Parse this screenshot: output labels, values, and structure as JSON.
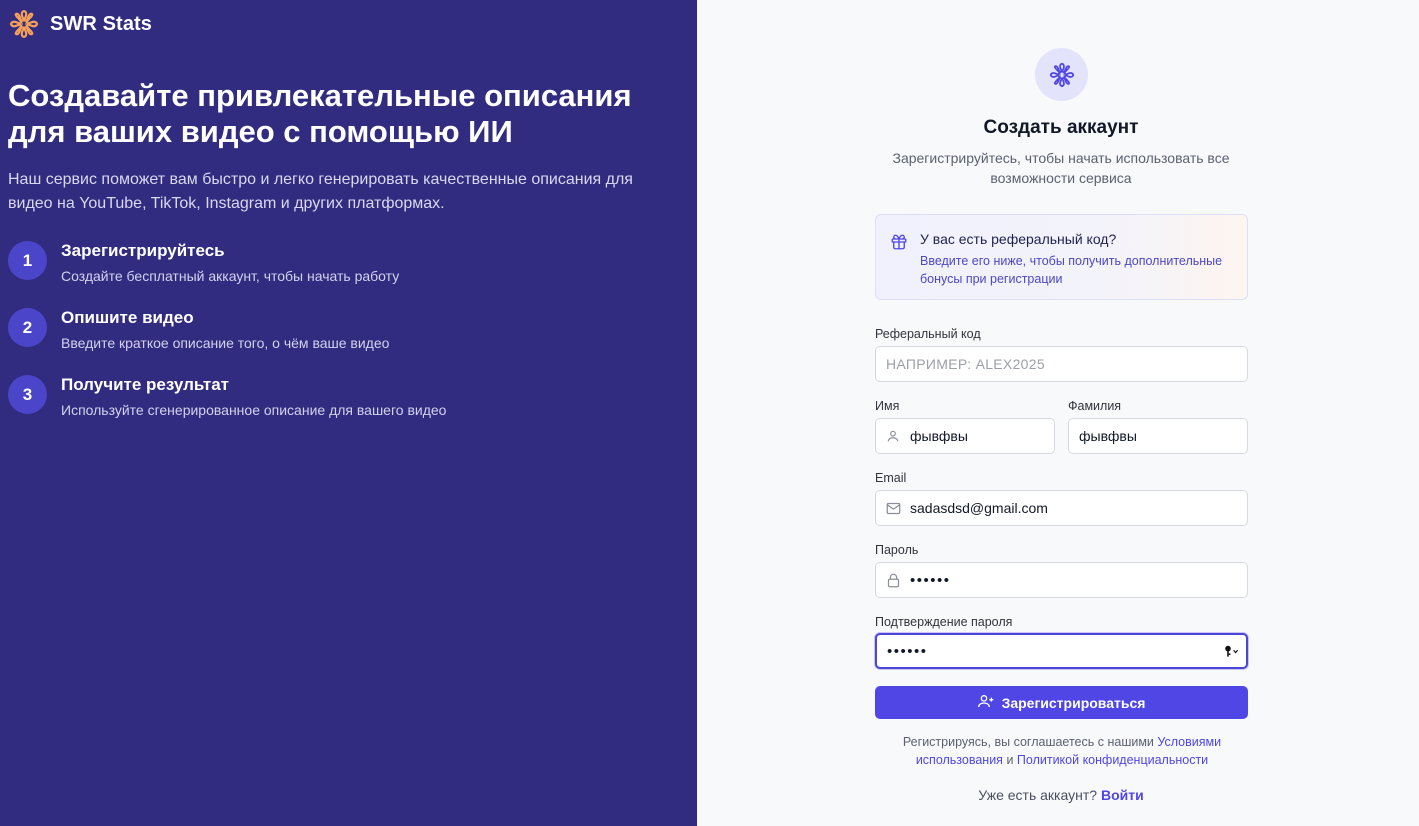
{
  "brand": {
    "name": "SWR Stats"
  },
  "hero": {
    "title": "Создавайте привлекательные описания для ваших видео с помощью ИИ",
    "lead": "Наш сервис поможет вам быстро и легко генерировать качественные описания для видео на YouTube, TikTok, Instagram и других платформах."
  },
  "steps": [
    {
      "num": "1",
      "title": "Зарегистрируйтесь",
      "desc": "Создайте бесплатный аккаунт, чтобы начать работу"
    },
    {
      "num": "2",
      "title": "Опишите видео",
      "desc": "Введите краткое описание того, о чём ваше видео"
    },
    {
      "num": "3",
      "title": "Получите результат",
      "desc": "Используйте сгенерированное описание для вашего видео"
    }
  ],
  "form": {
    "title": "Создать аккаунт",
    "subtitle": "Зарегистрируйтесь, чтобы начать использовать все возможности сервиса",
    "referral_box": {
      "heading": "У вас есть реферальный код?",
      "text": "Введите его ниже, чтобы получить дополнительные бонусы при регистрации"
    },
    "referral": {
      "label": "Реферальный код",
      "placeholder": "НАПРИМЕР: ALEX2025",
      "value": ""
    },
    "first_name": {
      "label": "Имя",
      "value": "фывфвы"
    },
    "last_name": {
      "label": "Фамилия",
      "value": "фывфвы"
    },
    "email": {
      "label": "Email",
      "value": "sadasdsd@gmail.com"
    },
    "password": {
      "label": "Пароль",
      "value": "••••••"
    },
    "confirm_password": {
      "label": "Подтверждение пароля",
      "value": "••••••"
    },
    "submit_label": "Зарегистрироваться",
    "terms_prefix": "Регистрируясь, вы соглашаетесь с нашими",
    "terms_link": "Условиями использования",
    "terms_and": "и",
    "privacy_link": "Политикой конфиденциальности",
    "login_prompt": "Уже есть аккаунт?",
    "login_link": "Войти"
  },
  "colors": {
    "left_bg": "#312c80",
    "accent": "#4f46e5",
    "logo_orange": "#f5a05a"
  }
}
